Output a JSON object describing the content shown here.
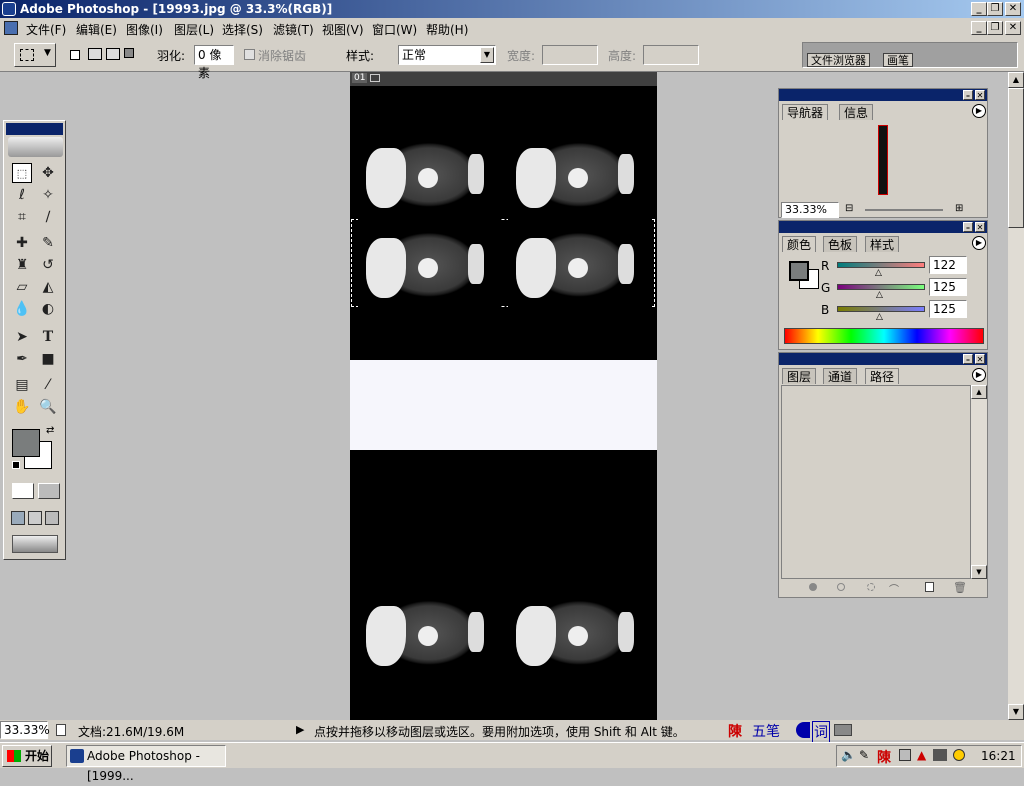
{
  "window": {
    "title": "Adobe Photoshop - [19993.jpg @ 33.3%(RGB)]"
  },
  "menu": {
    "items": [
      "文件(F)",
      "编辑(E)",
      "图像(I)",
      "图层(L)",
      "选择(S)",
      "滤镜(T)",
      "视图(V)",
      "窗口(W)",
      "帮助(H)"
    ]
  },
  "options": {
    "feather_label": "羽化:",
    "feather_value": "0 像素",
    "antialias_label": "消除锯齿",
    "style_label": "样式:",
    "style_value": "正常",
    "width_label": "宽度:",
    "height_label": "高度:",
    "well_tab1": "文件浏览器",
    "well_tab2": "画笔"
  },
  "document": {
    "tag": "01"
  },
  "navigator": {
    "tabs": [
      "导航器",
      "信息"
    ],
    "zoom": "33.33%"
  },
  "color_panel": {
    "tabs": [
      "颜色",
      "色板",
      "样式"
    ],
    "channels": [
      {
        "label": "R",
        "value": "122"
      },
      {
        "label": "G",
        "value": "125"
      },
      {
        "label": "B",
        "value": "125"
      }
    ],
    "foreground": "#7a7d7d"
  },
  "layers_panel": {
    "tabs": [
      "图层",
      "通道",
      "路径"
    ]
  },
  "status": {
    "zoom": "33.33%",
    "doc_size": "文档:21.6M/19.6M",
    "hint": "点按并拖移以移动图层或选区。要用附加选项，使用 Shift 和 Alt 键。",
    "ime1": "陳",
    "ime2": "五笔",
    "ime3": "词"
  },
  "taskbar": {
    "start": "开始",
    "task": "Adobe Photoshop - [1999...",
    "tray_ime": "陳",
    "clock": "16:21"
  },
  "icons": [
    "photoshop-icon",
    "marquee-icon",
    "move-icon",
    "lasso-icon",
    "magic-wand-icon",
    "crop-icon",
    "slice-icon",
    "healing-icon",
    "brush-icon",
    "stamp-icon",
    "history-brush-icon",
    "eraser-icon",
    "bucket-icon",
    "blur-icon",
    "dodge-icon",
    "path-select-icon",
    "type-icon",
    "pen-icon",
    "shape-icon",
    "notes-icon",
    "eyedropper-icon",
    "hand-icon",
    "zoom-icon"
  ]
}
